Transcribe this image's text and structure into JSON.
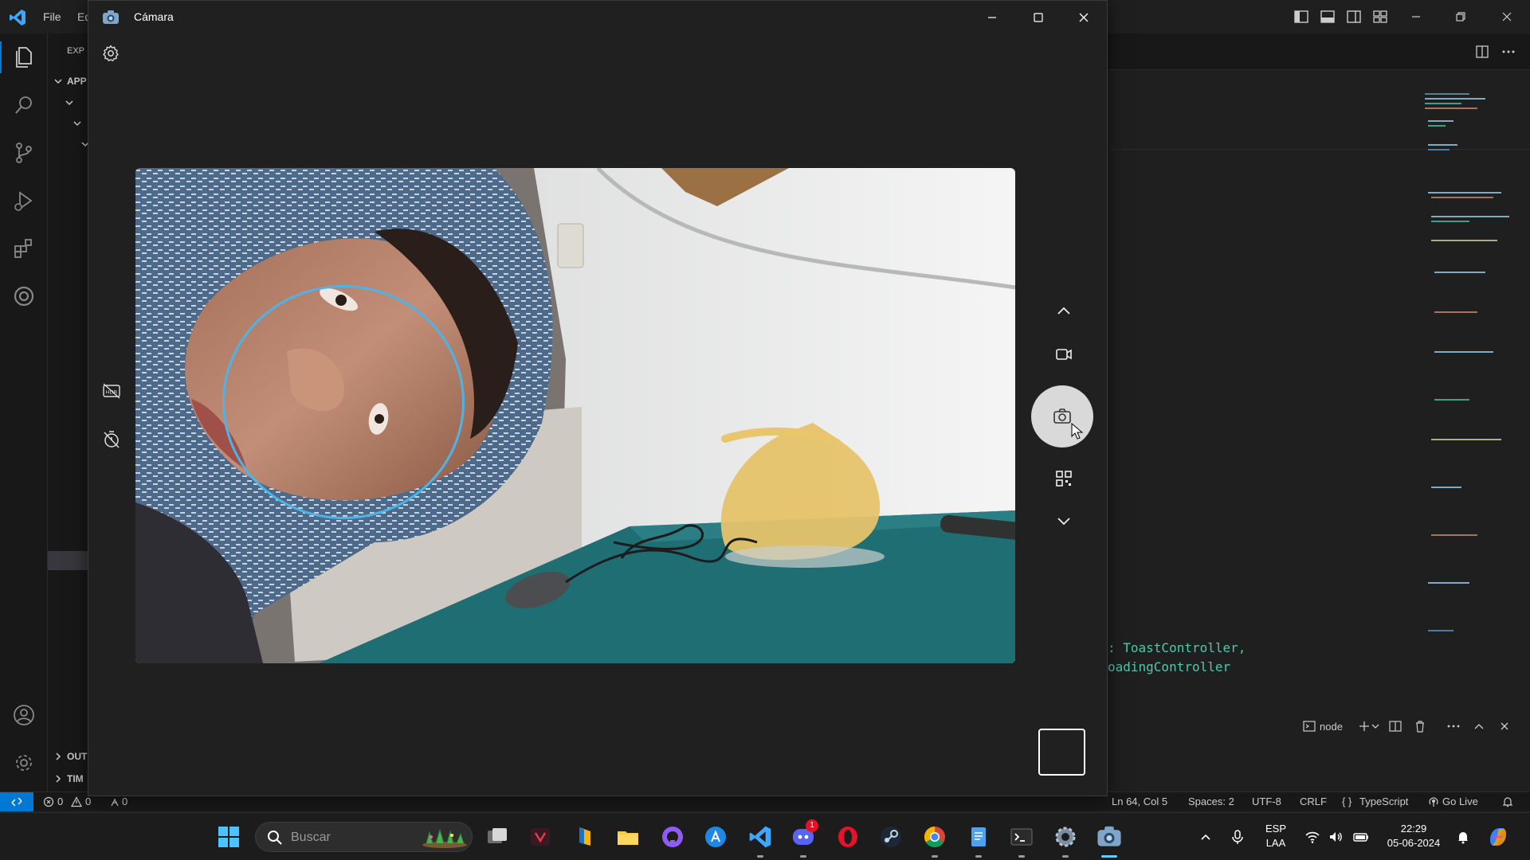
{
  "vscode": {
    "menu": [
      "File",
      "Ed"
    ],
    "sidebar": {
      "explorer_header": "EXP",
      "folder": "APP",
      "outline": "OUT",
      "timeline": "TIM"
    },
    "code_lines": [
      ": ToastController,",
      "oadingController"
    ],
    "panel": {
      "terminal_name": "node"
    },
    "statusbar": {
      "errors": "0",
      "warnings": "0",
      "ports": "0",
      "position": "Ln 64, Col 5",
      "spaces": "Spaces: 2",
      "encoding": "UTF-8",
      "eol": "CRLF",
      "language": "TypeScript",
      "golive": "Go Live"
    }
  },
  "camera": {
    "title": "Cámara",
    "colors": {
      "face_circle": "#4cb4e7",
      "shutter": "#d9d9d9"
    },
    "mode_icons": [
      "chevron-up-icon",
      "video-mode-icon",
      "photo-capture-icon",
      "qr-scan-icon",
      "chevron-down-icon"
    ]
  },
  "taskbar": {
    "search_placeholder": "Buscar",
    "discord_badge": "1",
    "lang_top": "ESP",
    "lang_bottom": "LAA",
    "time": "22:29",
    "date": "05-06-2024"
  }
}
